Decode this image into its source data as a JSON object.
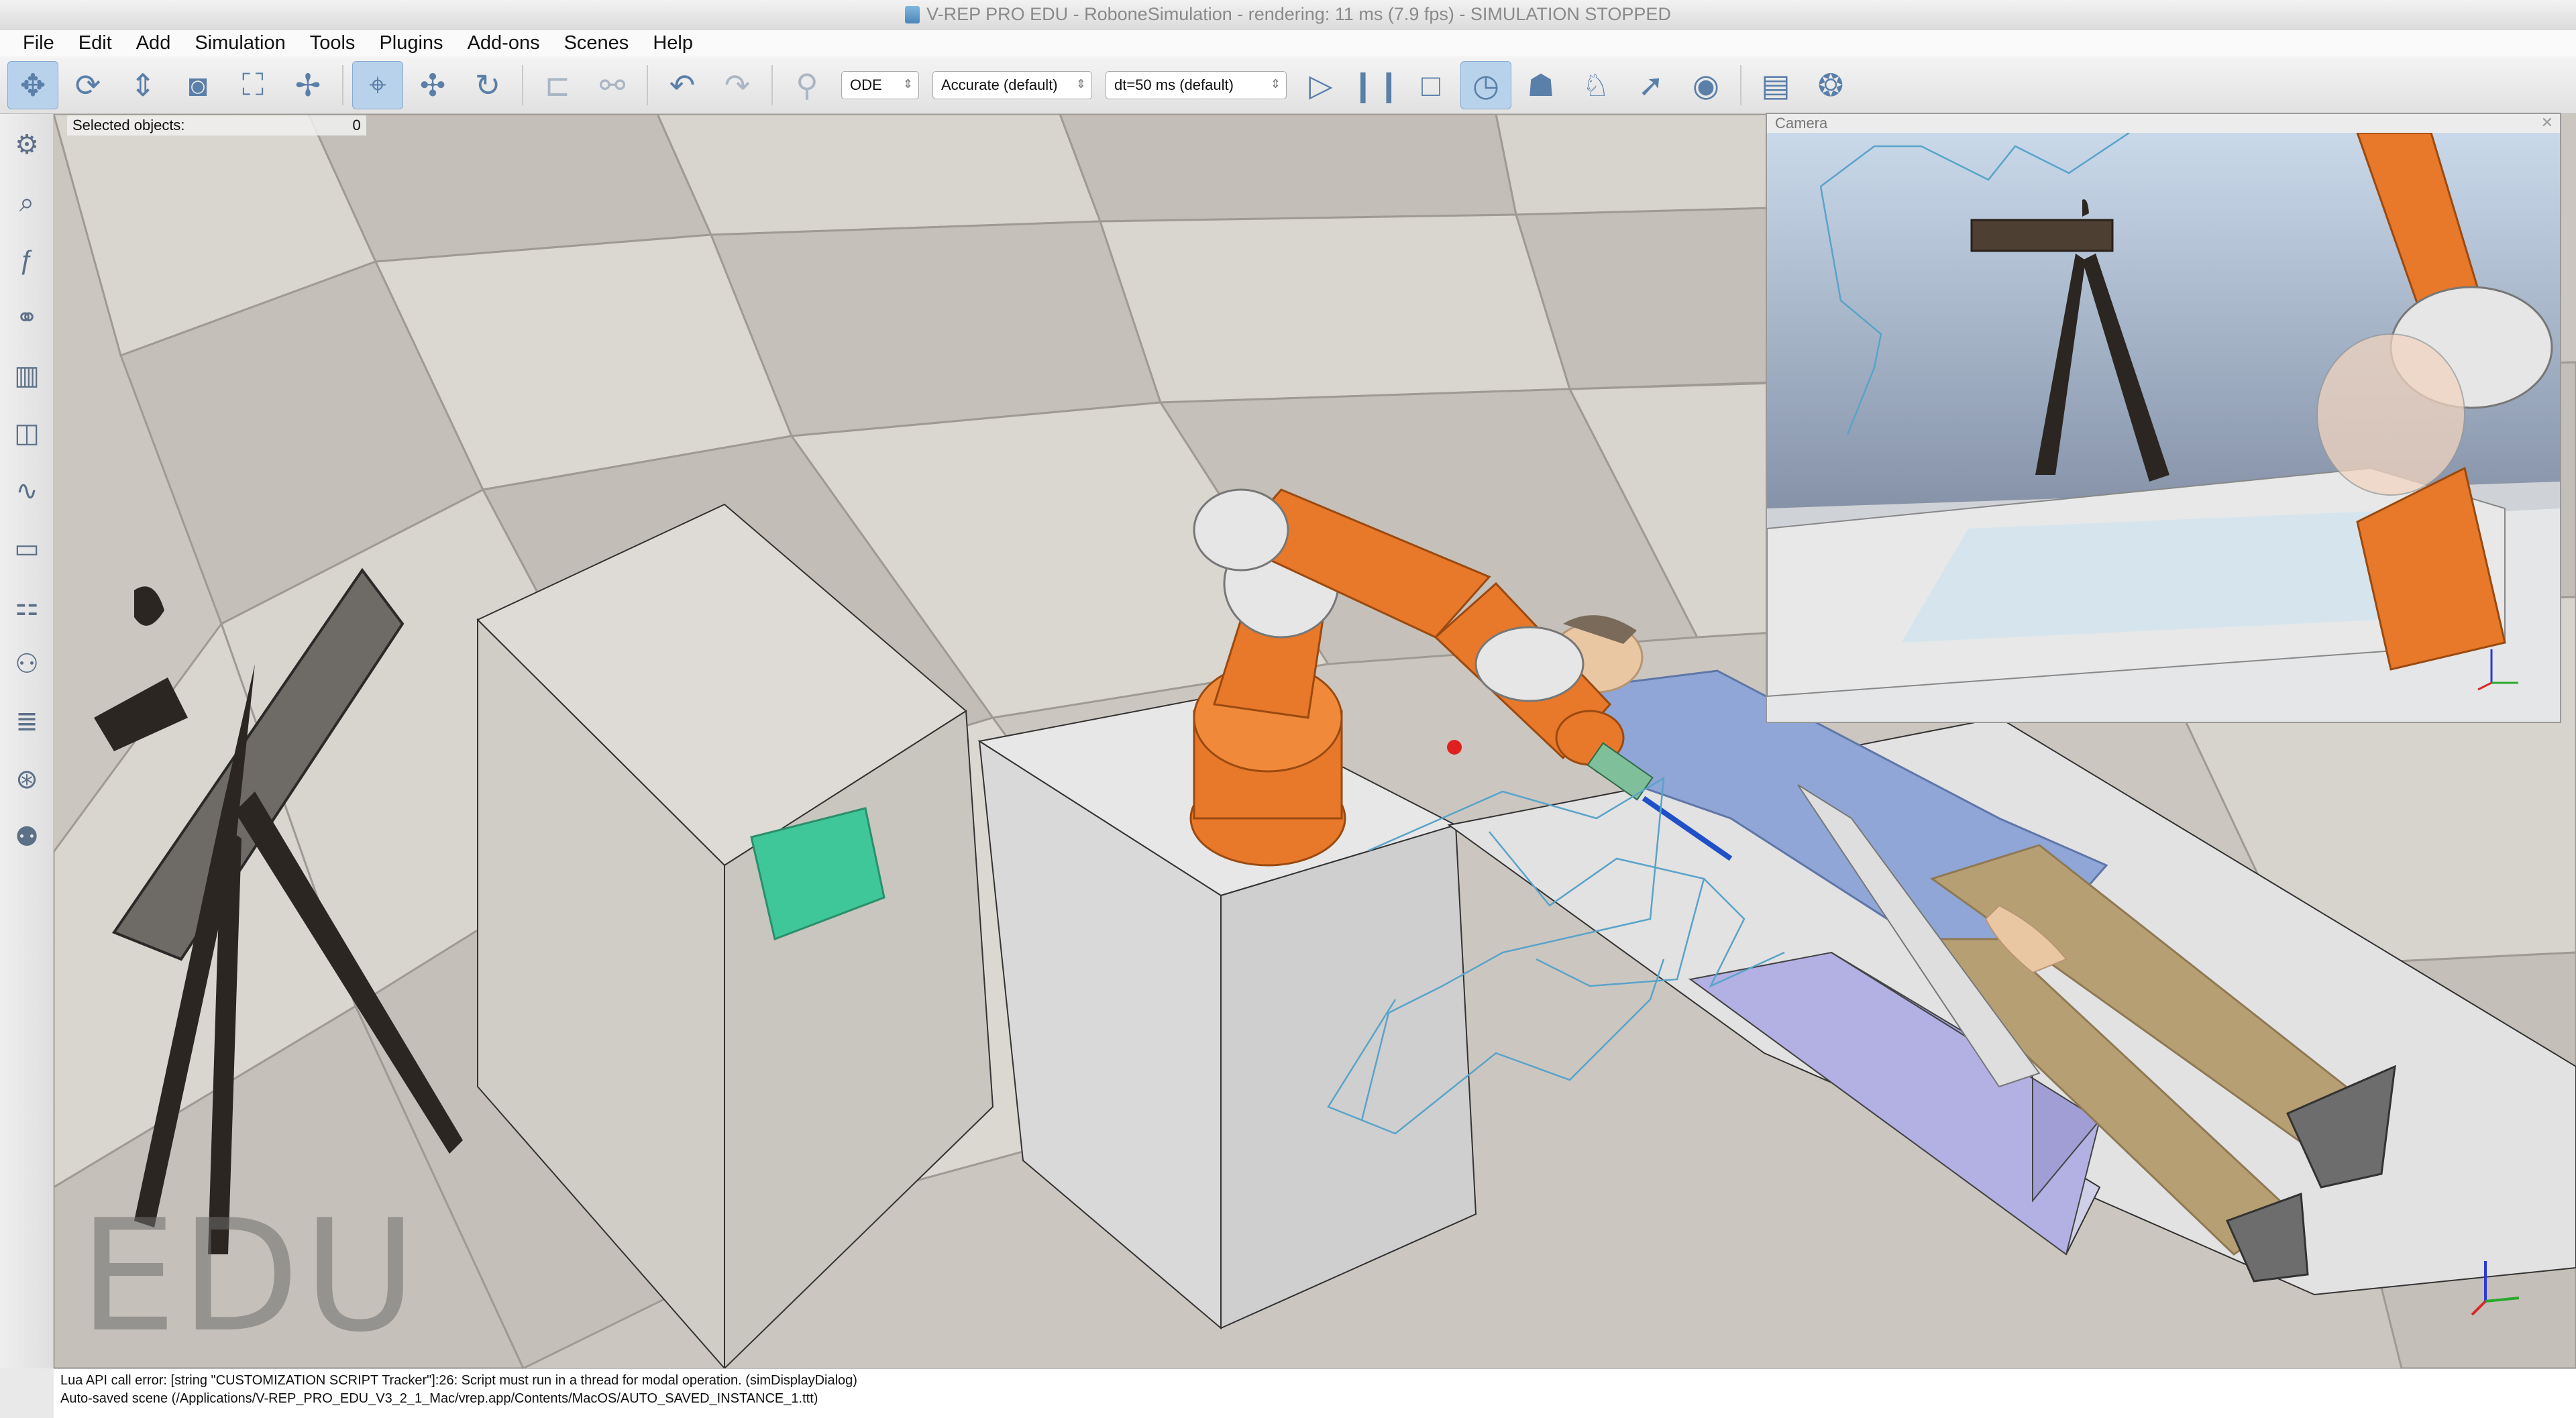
{
  "window": {
    "title": "V-REP PRO EDU - RoboneSimulation - rendering: 11 ms (7.9 fps) - SIMULATION STOPPED"
  },
  "menu": [
    "File",
    "Edit",
    "Add",
    "Simulation",
    "Tools",
    "Plugins",
    "Add-ons",
    "Scenes",
    "Help"
  ],
  "toolbar": {
    "engine": "ODE",
    "accuracy": "Accurate (default)",
    "timestep": "dt=50 ms (default)",
    "icons": {
      "camera_pan": "move-arrows-icon",
      "camera_rotate": "rotate-icon",
      "camera_shift": "shift-icon",
      "camera_angle": "camera-icon",
      "fit_view": "fit-icon",
      "camera_fly": "dragonfly-icon",
      "click_select": "click-select-icon",
      "object_shift": "object-shift-icon",
      "object_rotate": "object-rotate-icon",
      "assemble": "assemble-icon",
      "transfer_dna": "dna-icon",
      "undo": "undo-icon",
      "redo": "redo-icon",
      "dynamics_toggle": "dynamics-icon",
      "play": "play-icon",
      "pause": "pause-icon",
      "stop": "stop-icon",
      "realtime": "clock-icon",
      "slow_down": "turtle-icon",
      "speed_up": "rabbit-icon",
      "thread_switch": "rocket-icon",
      "visualization": "eye-icon",
      "page_selector": "pages-icon",
      "scene_selector": "scenes-icon"
    }
  },
  "left_toolbar": {
    "icons": [
      "simulation-settings-icon",
      "selection-icon",
      "calculation-module-icon",
      "hierarchy-icon",
      "script-icon",
      "shape-edit-icon",
      "path-edit-icon",
      "user-interface-icon",
      "collections-icon",
      "ik-icon",
      "layers-icon",
      "video-recorder-icon",
      "user-settings-icon"
    ]
  },
  "viewport": {
    "selected_label": "Selected objects:",
    "selected_count": "0",
    "watermark": "EDU"
  },
  "camera_view": {
    "title": "Camera"
  },
  "console": {
    "line1": "Lua API call error: [string \"CUSTOMIZATION SCRIPT Tracker\"]:26: Script must run in a thread for modal operation. (simDisplayDialog)",
    "line2": "Auto-saved scene (/Applications/V-REP_PRO_EDU_V3_2_1_Mac/vrep.app/Contents/MacOS/AUTO_SAVED_INSTANCE_1.ttt)"
  },
  "colors": {
    "robot_orange": "#e8782a",
    "robot_white": "#e6e6e6",
    "floor_light": "#d9d5cf",
    "floor_dark": "#bdb8b1",
    "patient_shirt": "#8fa6d6",
    "patient_pants": "#b79f74",
    "marker_green": "#3fc79a",
    "cushion_lilac": "#b3b0e4"
  }
}
